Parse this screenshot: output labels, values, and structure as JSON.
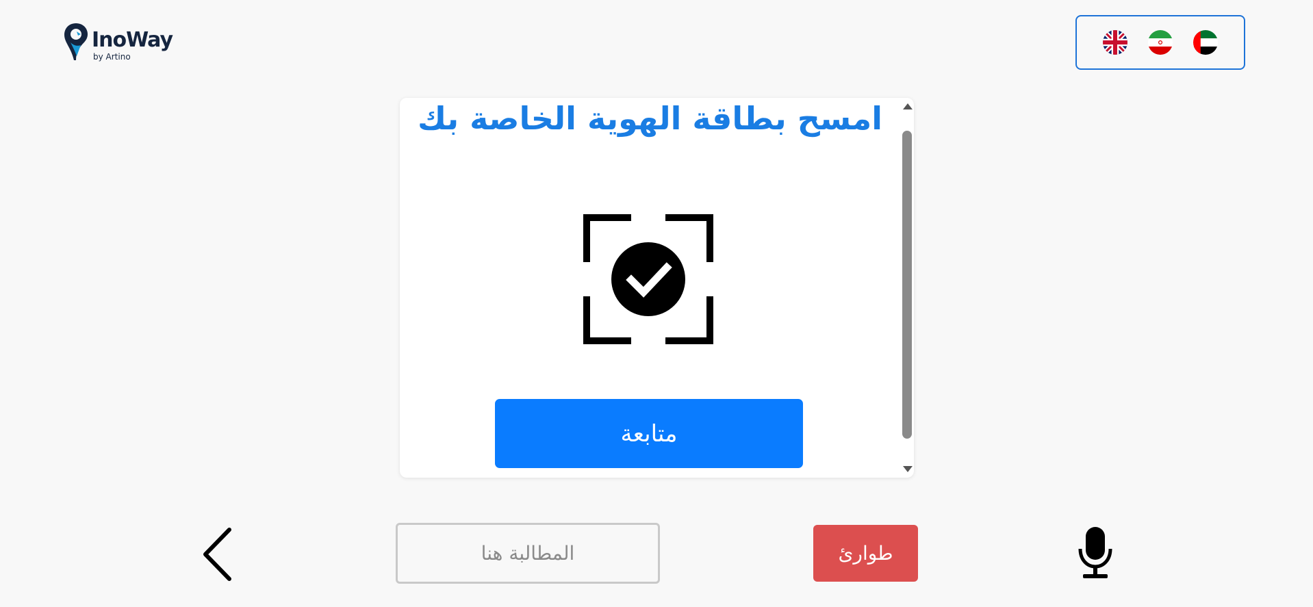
{
  "header": {
    "logo": {
      "name": "InoWay",
      "sub": "by Artino",
      "icon": "location-pin-logo"
    },
    "languages": [
      {
        "code": "en",
        "icon": "uk-flag-icon"
      },
      {
        "code": "fa",
        "icon": "iran-flag-icon"
      },
      {
        "code": "ar",
        "icon": "uae-flag-icon"
      }
    ],
    "accent_color": "#1d73d8"
  },
  "card": {
    "title": "امسح بطاقة الهوية الخاصة بك",
    "icon": "scan-check-icon",
    "continue_label": "متابعة",
    "title_color": "#1a7de3",
    "button_color": "#0a7cff"
  },
  "bottom_bar": {
    "back_icon": "chevron-left-icon",
    "claim_placeholder": "المطالبة هنا",
    "claim_value": "",
    "emergency_label": "طوارئ",
    "emergency_color": "#dc4f4f",
    "mic_icon": "microphone-icon"
  }
}
